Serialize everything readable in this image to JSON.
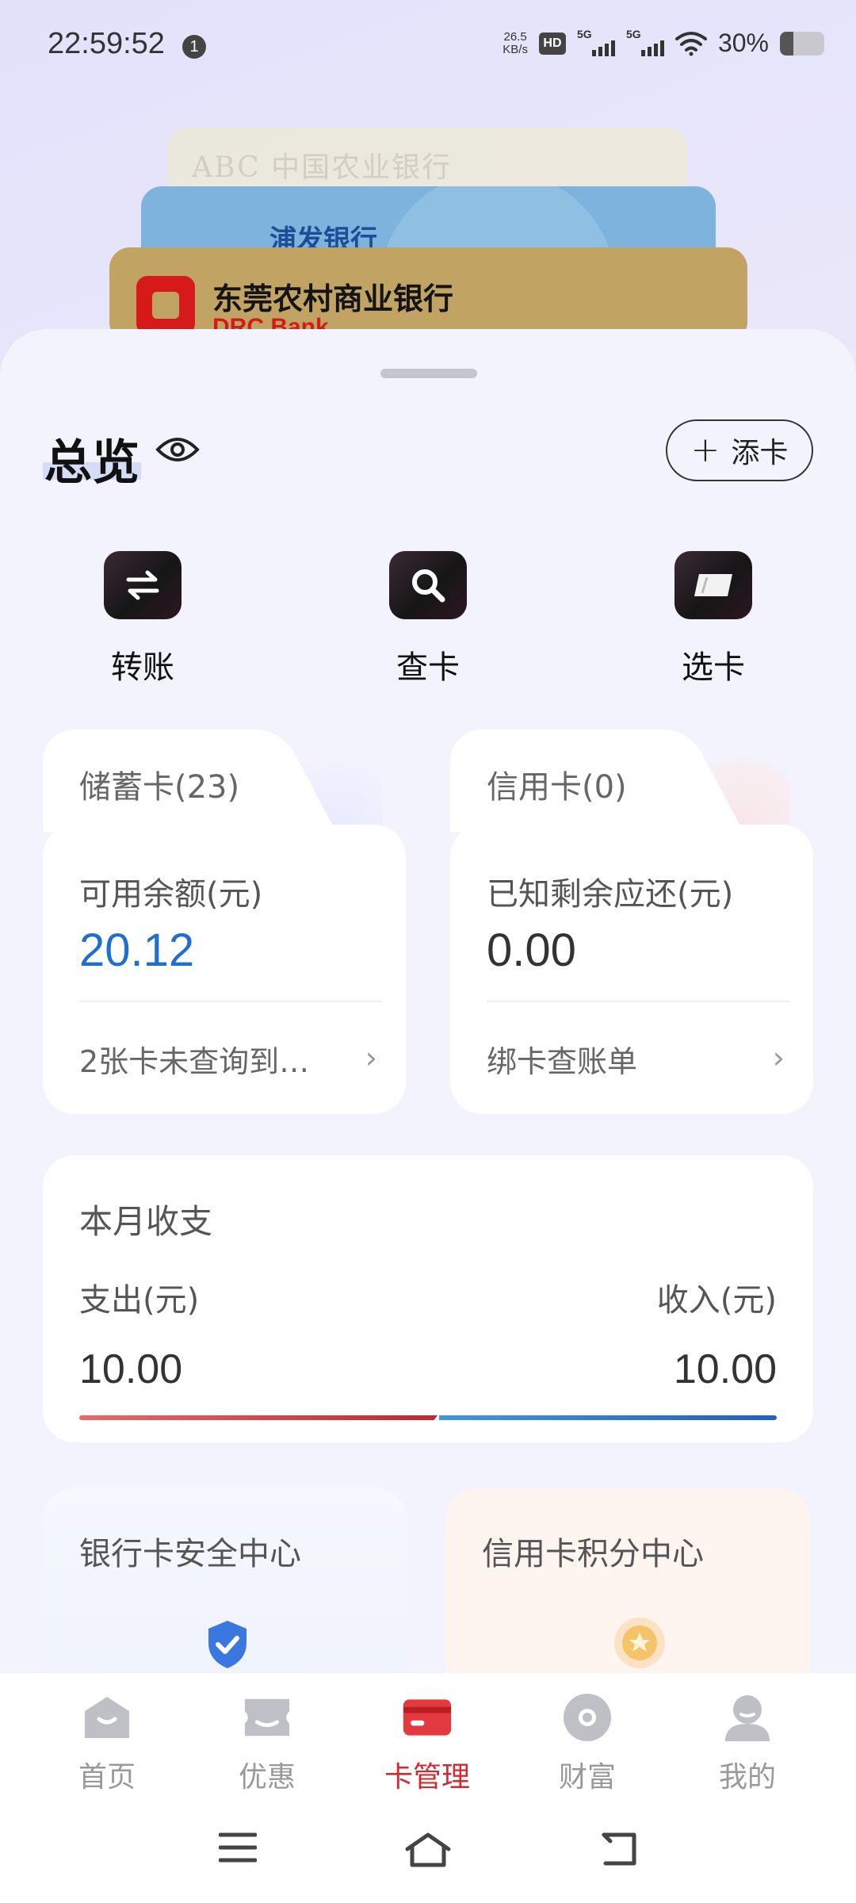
{
  "status_bar": {
    "time": "22:59:52",
    "notification_count": "1",
    "net_speed_value": "26.5",
    "net_speed_unit": "KB/s",
    "hd_label": "HD",
    "sim1_label": "5G",
    "sim2_label": "5G",
    "battery_percent": "30%",
    "battery_level": 0.3
  },
  "card_stack": [
    {
      "name": "ABC 中国农业银行",
      "color": "#ece9d8"
    },
    {
      "name": "浦发银行",
      "color": "#7db3dc"
    },
    {
      "name": "东莞农村商业银行",
      "name_en": "DRC Bank",
      "color": "#c1a464"
    }
  ],
  "overview": {
    "title": "总览",
    "add_card_label": "添卡"
  },
  "quick_actions": [
    {
      "label": "转账",
      "icon": "transfer-icon"
    },
    {
      "label": "查卡",
      "icon": "search-icon"
    },
    {
      "label": "选卡",
      "icon": "card-icon"
    }
  ],
  "debit": {
    "title": "储蓄卡(23)",
    "balance_label": "可用余额(元)",
    "balance": "20.12",
    "link": "2张卡未查询到…"
  },
  "credit": {
    "title": "信用卡(0)",
    "balance_label": "已知剩余应还(元)",
    "balance": "0.00",
    "link": "绑卡查账单"
  },
  "monthly": {
    "title": "本月收支",
    "expense_label": "支出(元)",
    "income_label": "收入(元)",
    "expense": "10.00",
    "income": "10.00"
  },
  "centers": {
    "security": "银行卡安全中心",
    "points": "信用卡积分中心"
  },
  "bottom_nav": [
    {
      "label": "首页",
      "icon": "home-icon",
      "active": false
    },
    {
      "label": "优惠",
      "icon": "ticket-icon",
      "active": false
    },
    {
      "label": "卡管理",
      "icon": "card-manage-icon",
      "active": true
    },
    {
      "label": "财富",
      "icon": "wealth-icon",
      "active": false
    },
    {
      "label": "我的",
      "icon": "profile-icon",
      "active": false
    }
  ],
  "colors": {
    "accent_red": "#d4292f",
    "balance_blue": "#1f6fcf"
  }
}
